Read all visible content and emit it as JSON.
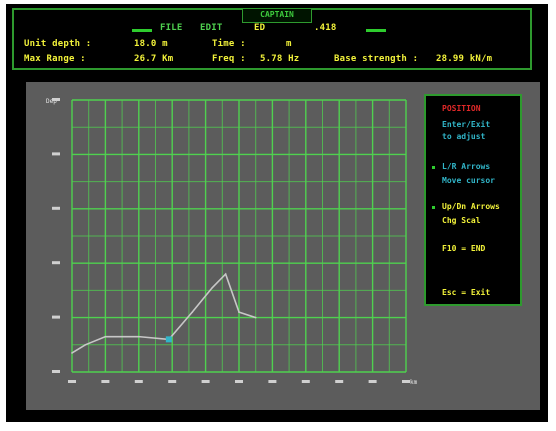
{
  "header": {
    "title": "CAPTAIN",
    "mode_line": [
      {
        "label": "FILE",
        "value": "EDIT"
      },
      {
        "label": "ED",
        "value": ".418"
      }
    ],
    "row1": [
      {
        "label": "Unit depth :",
        "value": "18.0 m"
      },
      {
        "label": "Time :",
        "value": "m"
      }
    ],
    "row2": [
      {
        "label": "Max Range :",
        "value": "26.7 Km"
      },
      {
        "label": "Freq :",
        "value": "5.78 Hz"
      },
      {
        "label": "Base strength :",
        "value": "28.99 kN/m"
      }
    ]
  },
  "side_panel": {
    "selected": "POSITION",
    "lines": [
      "Enter/Exit",
      "to adjust",
      "L/R Arrows",
      "Move cursor",
      "Up/Dn Arrows",
      "Chg Scal",
      "F10 = END",
      "Esc = Exit"
    ]
  },
  "colors": {
    "grid": "#4fd14f",
    "series": "#c7c7c7",
    "cursor": "#31b5c8",
    "header_text": "#f2f23a",
    "selected_text": "#e02828",
    "info_text": "#31b5c8",
    "plot_bg": "#5c5c5c"
  },
  "chart_data": {
    "type": "line",
    "y_ticks": [
      "",
      "",
      "",
      "",
      "",
      ""
    ],
    "y_top_label": "Dep",
    "x_ticks": [
      "",
      "",
      "",
      "",
      "",
      "",
      "",
      "",
      "",
      "",
      ""
    ],
    "x_unit": "km",
    "xlim": [
      0,
      10
    ],
    "ylim": [
      0,
      5
    ],
    "grid": true,
    "series": [
      {
        "x": [
          0,
          0.4,
          1.0,
          2.0,
          2.9,
          3.6,
          4.2,
          4.6,
          5.0,
          5.5
        ],
        "y": [
          0.35,
          0.5,
          0.65,
          0.65,
          0.6,
          1.1,
          1.55,
          1.8,
          1.1,
          1.0
        ]
      }
    ],
    "cursor": {
      "x": 2.9,
      "y": 0.6
    }
  }
}
